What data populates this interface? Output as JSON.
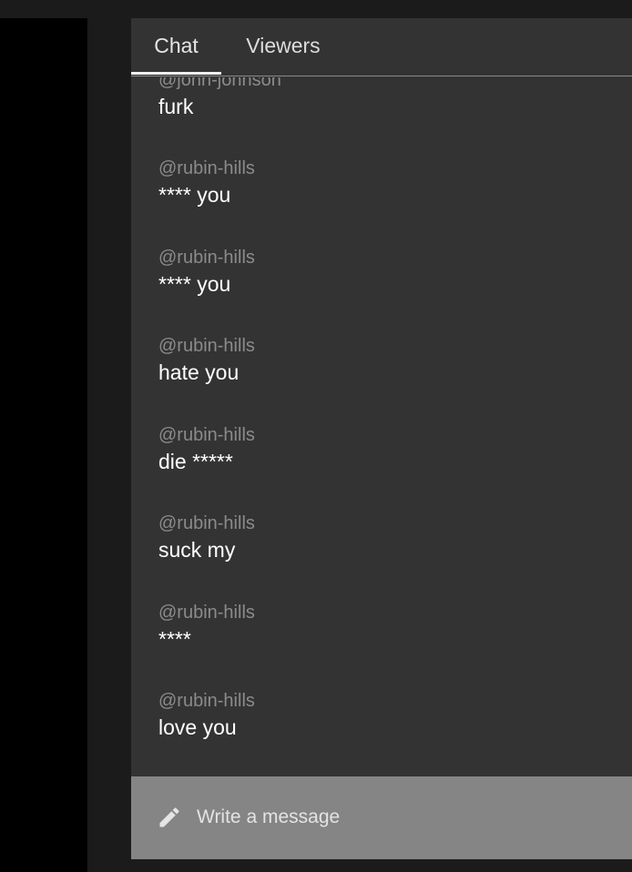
{
  "tabs": {
    "chat": "Chat",
    "viewers": "Viewers",
    "active": "Chat"
  },
  "messages": [
    {
      "author": "@john-johnson",
      "text": "furk"
    },
    {
      "author": "@rubin-hills",
      "text": "**** you"
    },
    {
      "author": "@rubin-hills",
      "text": "**** you"
    },
    {
      "author": "@rubin-hills",
      "text": "hate you"
    },
    {
      "author": "@rubin-hills",
      "text": "die *****"
    },
    {
      "author": "@rubin-hills",
      "text": "suck my"
    },
    {
      "author": "@rubin-hills",
      "text": "****"
    },
    {
      "author": "@rubin-hills",
      "text": "love you"
    }
  ],
  "composer": {
    "placeholder": "Write a message",
    "value": "",
    "icon": "pencil-icon"
  },
  "colors": {
    "panel": "#333333",
    "composer": "#858585",
    "author": "#8b8b8b",
    "text": "#ffffff"
  }
}
